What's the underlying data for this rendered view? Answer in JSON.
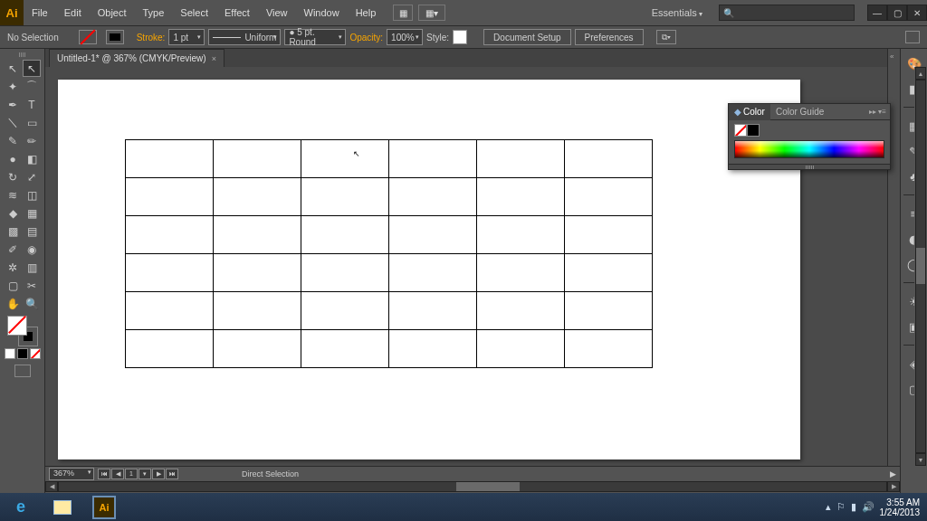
{
  "menubar": {
    "logo": "Ai",
    "items": [
      "File",
      "Edit",
      "Object",
      "Type",
      "Select",
      "Effect",
      "View",
      "Window",
      "Help"
    ],
    "workspace": "Essentials",
    "search_placeholder": "🔍"
  },
  "ctrlbar": {
    "selection": "No Selection",
    "stroke_label": "Stroke:",
    "stroke_weight": "1 pt",
    "profile": "Uniform",
    "brush": "● 5 pt. Round",
    "opacity_label": "Opacity:",
    "opacity_value": "100%",
    "style_label": "Style:",
    "doc_setup": "Document Setup",
    "prefs": "Preferences"
  },
  "tab": {
    "title": "Untitled-1* @ 367% (CMYK/Preview)"
  },
  "statusbar": {
    "zoom": "367%",
    "page": "1",
    "tool": "Direct Selection"
  },
  "colorpanel": {
    "tab_color": "Color",
    "tab_guide": "Color Guide"
  },
  "taskbar": {
    "time": "3:55 AM",
    "date": "1/24/2013"
  },
  "floating_text": "⎀"
}
